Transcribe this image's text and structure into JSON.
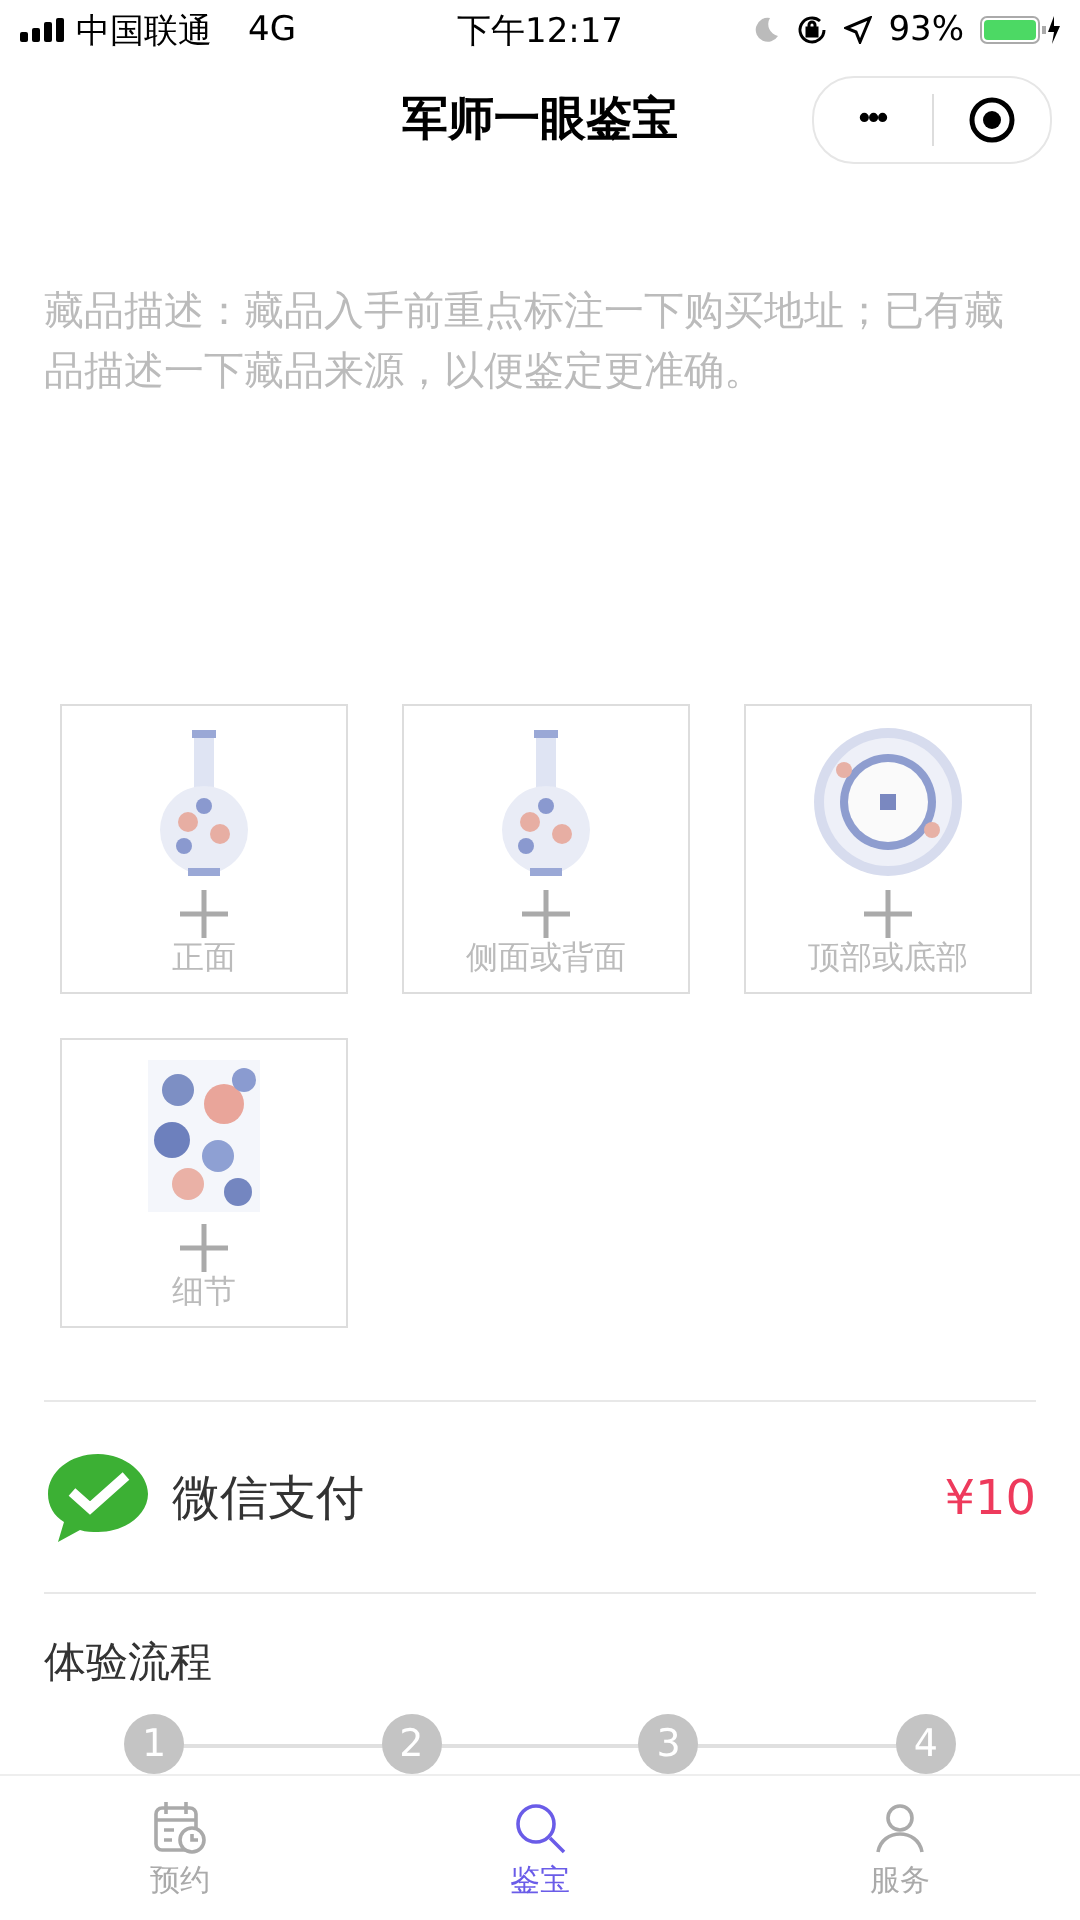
{
  "status_bar": {
    "carrier": "中国联通",
    "network": "4G",
    "time": "下午12:17",
    "battery": "93%"
  },
  "nav": {
    "title": "军师一眼鉴宝",
    "more": "•••"
  },
  "description": {
    "placeholder": "藏品描述：藏品入手前重点标注一下购买地址；已有藏品描述一下藏品来源，以便鉴定更准确。"
  },
  "photos": [
    {
      "label": "正面",
      "kind": "picture"
    },
    {
      "label": "侧面或背面",
      "kind": "picture"
    },
    {
      "label": "顶部或底部",
      "kind": "picture"
    },
    {
      "label": "细节",
      "kind": "picture"
    }
  ],
  "payment": {
    "method": "微信支付",
    "price": "¥10"
  },
  "process": {
    "title": "体验流程",
    "steps": [
      "1",
      "2",
      "3",
      "4"
    ]
  },
  "tab_bar": [
    {
      "label": "预约",
      "kind": "calendar",
      "selected": false
    },
    {
      "label": "鉴宝",
      "kind": "search",
      "selected": true
    },
    {
      "label": "服务",
      "kind": "person",
      "selected": false
    }
  ]
}
